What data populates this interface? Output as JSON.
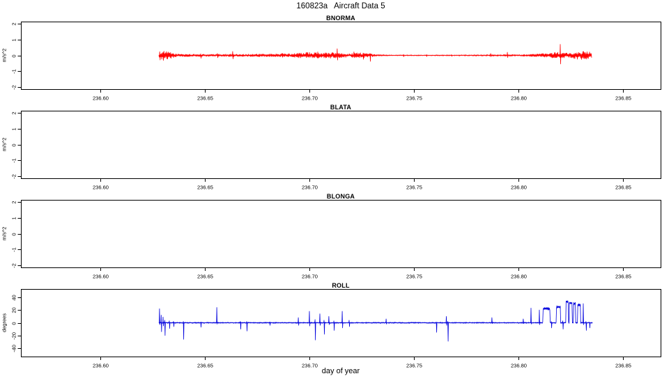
{
  "header": {
    "title": "160823a   Aircraft Data 5"
  },
  "xaxis": {
    "label": "day of year",
    "xlim": [
      236.562,
      236.868
    ],
    "ticks": [
      236.6,
      236.65,
      236.7,
      236.75,
      236.8,
      236.85
    ]
  },
  "colors": {
    "axis": "#000000",
    "background": "#ffffff",
    "accel_trace": "#ff0000",
    "roll_trace": "#0000dd"
  },
  "chart_data": [
    {
      "type": "line",
      "title": "BNORMA",
      "ylabel": "m/s^2",
      "ylim": [
        -2.15,
        2.15
      ],
      "yticks": [
        -2,
        -1,
        0,
        1,
        2
      ],
      "color": "#ff0000",
      "x_range": [
        236.628,
        236.835
      ],
      "baseline_noise": 0,
      "noise_envelope": [
        [
          236.628,
          0.05
        ],
        [
          236.6285,
          0.3
        ],
        [
          236.633,
          0.22
        ],
        [
          236.636,
          0.1
        ],
        [
          236.645,
          0.07
        ],
        [
          236.655,
          0.07
        ],
        [
          236.66,
          0.08
        ],
        [
          236.663,
          0.1
        ],
        [
          236.666,
          0.07
        ],
        [
          236.685,
          0.1
        ],
        [
          236.692,
          0.12
        ],
        [
          236.695,
          0.16
        ],
        [
          236.7,
          0.2
        ],
        [
          236.705,
          0.16
        ],
        [
          236.71,
          0.18
        ],
        [
          236.715,
          0.16
        ],
        [
          236.719,
          0.1
        ],
        [
          236.723,
          0.18
        ],
        [
          236.729,
          0.12
        ],
        [
          236.732,
          0.05
        ],
        [
          236.74,
          0.035
        ],
        [
          236.76,
          0.03
        ],
        [
          236.775,
          0.04
        ],
        [
          236.79,
          0.05
        ],
        [
          236.8,
          0.05
        ],
        [
          236.806,
          0.07
        ],
        [
          236.81,
          0.11
        ],
        [
          236.815,
          0.14
        ],
        [
          236.8185,
          0.22
        ],
        [
          236.821,
          0.16
        ],
        [
          236.825,
          0.14
        ],
        [
          236.828,
          0.26
        ],
        [
          236.833,
          0.26
        ],
        [
          236.835,
          0.18
        ]
      ],
      "spikes": [
        [
          236.63,
          0.2,
          -0.32
        ],
        [
          236.648,
          0.1,
          -0.18
        ],
        [
          236.656,
          0.12,
          -0.15
        ],
        [
          236.6633,
          0.25,
          -0.22
        ],
        [
          236.687,
          0.14,
          -0.12
        ],
        [
          236.704,
          0.22,
          -0.18
        ],
        [
          236.7133,
          0.42,
          -0.3
        ],
        [
          236.7213,
          0.22,
          -0.15
        ],
        [
          236.7257,
          0.15,
          -0.25
        ],
        [
          236.729,
          0.1,
          -0.38
        ],
        [
          236.745,
          0.06,
          -0.08
        ],
        [
          236.756,
          0.05,
          -0.07
        ],
        [
          236.768,
          0.05,
          -0.06
        ],
        [
          236.7867,
          0.12,
          -0.08
        ],
        [
          236.7947,
          0.2,
          -0.14
        ],
        [
          236.82,
          0.7,
          -0.55
        ]
      ],
      "pulses": []
    },
    {
      "type": "line",
      "title": "BLATA",
      "ylabel": "m/s^2",
      "ylim": [
        -2.15,
        2.15
      ],
      "yticks": [
        -2,
        -1,
        0,
        1,
        2
      ],
      "color": null,
      "x_range": null,
      "baseline_noise": 0,
      "noise_envelope": [],
      "spikes": [],
      "pulses": []
    },
    {
      "type": "line",
      "title": "BLONGA",
      "ylabel": "m/s^2",
      "ylim": [
        -2.15,
        2.15
      ],
      "yticks": [
        -2,
        -1,
        0,
        1,
        2
      ],
      "color": null,
      "x_range": null,
      "baseline_noise": 0,
      "noise_envelope": [],
      "spikes": [],
      "pulses": []
    },
    {
      "type": "line",
      "title": "ROLL",
      "ylabel": "degrees",
      "ylim": [
        -53,
        53
      ],
      "yticks": [
        -40,
        -20,
        0,
        20,
        40
      ],
      "color": "#0000dd",
      "x_range": [
        236.628,
        236.8355
      ],
      "baseline_noise": 0.9,
      "noise_envelope": [],
      "spikes": [
        [
          236.6283,
          22,
          -3
        ],
        [
          236.6291,
          12,
          -14
        ],
        [
          236.63,
          9,
          -5
        ],
        [
          236.6308,
          4,
          -20
        ],
        [
          236.633,
          3,
          -9
        ],
        [
          236.635,
          2,
          -6
        ],
        [
          236.6397,
          2,
          -26
        ],
        [
          236.648,
          1,
          -7
        ],
        [
          236.6557,
          24,
          -2
        ],
        [
          236.667,
          2,
          -10
        ],
        [
          236.67,
          2,
          -13
        ],
        [
          236.681,
          1,
          -4
        ],
        [
          236.6947,
          8,
          -4
        ],
        [
          236.7,
          18,
          -5
        ],
        [
          236.7027,
          5,
          -27
        ],
        [
          236.705,
          14,
          -4
        ],
        [
          236.707,
          4,
          -18
        ],
        [
          236.7093,
          10,
          -3
        ],
        [
          236.7117,
          3,
          -12
        ],
        [
          236.7157,
          18,
          -8
        ],
        [
          236.719,
          4,
          -6
        ],
        [
          236.7367,
          6,
          -2
        ],
        [
          236.7607,
          1,
          -15
        ],
        [
          236.7655,
          10,
          -4
        ],
        [
          236.7662,
          2,
          -29
        ],
        [
          236.7873,
          8,
          -1
        ],
        [
          236.8023,
          6,
          -1
        ],
        [
          236.806,
          23,
          -2
        ],
        [
          236.81,
          20,
          -3
        ],
        [
          236.8157,
          2,
          -8
        ],
        [
          236.8212,
          3,
          -10
        ],
        [
          236.831,
          30,
          -3
        ],
        [
          236.8323,
          2,
          -12
        ],
        [
          236.834,
          1,
          -8
        ]
      ],
      "pulses": [
        [
          236.8117,
          236.815,
          22
        ],
        [
          236.818,
          236.82,
          25
        ],
        [
          236.8227,
          236.8238,
          33
        ],
        [
          236.8243,
          236.8257,
          31
        ],
        [
          236.8262,
          236.8272,
          30
        ],
        [
          236.8283,
          236.8297,
          28
        ]
      ]
    }
  ]
}
